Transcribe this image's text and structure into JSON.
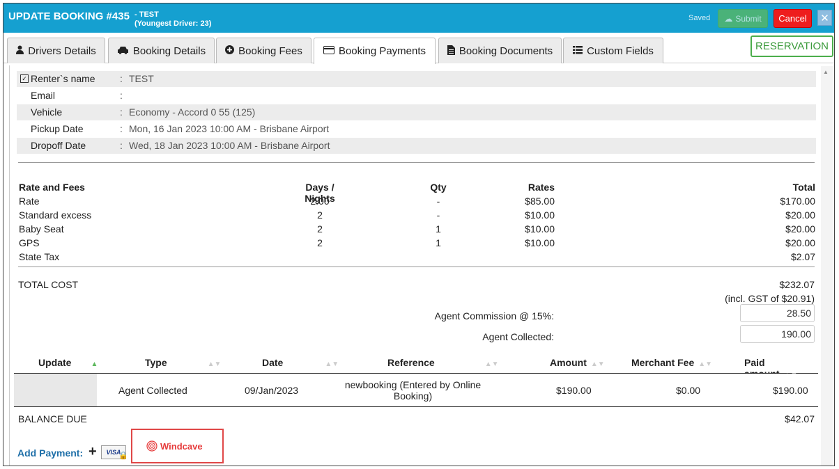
{
  "header": {
    "title": "UPDATE BOOKING #435",
    "subtitle_name": "- TEST",
    "subtitle_driver": "(Youngest Driver: 23)",
    "saved_label": "Saved",
    "submit_label": "Submit",
    "cancel_label": "Cancel",
    "close_label": "✕",
    "accent_color": "#15a0d0"
  },
  "tabs": [
    {
      "label": "Drivers Details",
      "icon": "user-icon"
    },
    {
      "label": "Booking Details",
      "icon": "car-icon"
    },
    {
      "label": "Booking Fees",
      "icon": "plus-circle-icon"
    },
    {
      "label": "Booking Payments",
      "icon": "credit-card-icon",
      "active": true
    },
    {
      "label": "Booking Documents",
      "icon": "document-icon"
    },
    {
      "label": "Custom Fields",
      "icon": "list-icon"
    }
  ],
  "status_badge": "RESERVATION",
  "info": {
    "renter_label": "Renter`s name",
    "renter_value": "TEST",
    "email_label": "Email",
    "email_value": "",
    "vehicle_label": "Vehicle",
    "vehicle_value": "Economy - Accord 0 55 (125)",
    "pickup_label": "Pickup Date",
    "pickup_value": "Mon, 16 Jan 2023 10:00 AM - Brisbane Airport",
    "dropoff_label": "Dropoff Date",
    "dropoff_value": "Wed, 18 Jan 2023 10:00 AM - Brisbane Airport",
    "colon": ":"
  },
  "fees": {
    "headers": {
      "name": "Rate and Fees",
      "days": "Days / Nights",
      "qty": "Qty",
      "rate": "Rates",
      "total": "Total"
    },
    "rows": [
      {
        "name": "Rate",
        "days": "2.00",
        "qty": "-",
        "rate": "$85.00",
        "total": "$170.00"
      },
      {
        "name": "Standard excess",
        "days": "2",
        "qty": "-",
        "rate": "$10.00",
        "total": "$20.00"
      },
      {
        "name": "Baby Seat",
        "days": "2",
        "qty": "1",
        "rate": "$10.00",
        "total": "$20.00"
      },
      {
        "name": "GPS",
        "days": "2",
        "qty": "1",
        "rate": "$10.00",
        "total": "$20.00"
      },
      {
        "name": "State Tax",
        "days": "",
        "qty": "",
        "rate": "",
        "total": "$2.07"
      }
    ]
  },
  "totals": {
    "total_label": "TOTAL COST",
    "total_value": "$232.07",
    "gst": "(incl. GST of $20.91)",
    "commission_label": "Agent Commission @ 15%:",
    "commission_value": "28.50",
    "collected_label": "Agent Collected:",
    "collected_value": "190.00"
  },
  "payments": {
    "headers": {
      "update": "Update",
      "type": "Type",
      "date": "Date",
      "reference": "Reference",
      "amount": "Amount",
      "fee": "Merchant Fee",
      "paid": "Paid amount"
    },
    "rows": [
      {
        "type": "Agent Collected",
        "date": "09/Jan/2023",
        "reference_line1": "newbooking (Entered by Online",
        "reference_line2": "Booking)",
        "amount": "$190.00",
        "fee": "$0.00",
        "paid": "$190.00"
      }
    ]
  },
  "balance": {
    "label": "BALANCE DUE",
    "value": "$42.07"
  },
  "add_payment": {
    "label": "Add Payment:",
    "card_text": "VISA",
    "gateway": "Windcave"
  }
}
